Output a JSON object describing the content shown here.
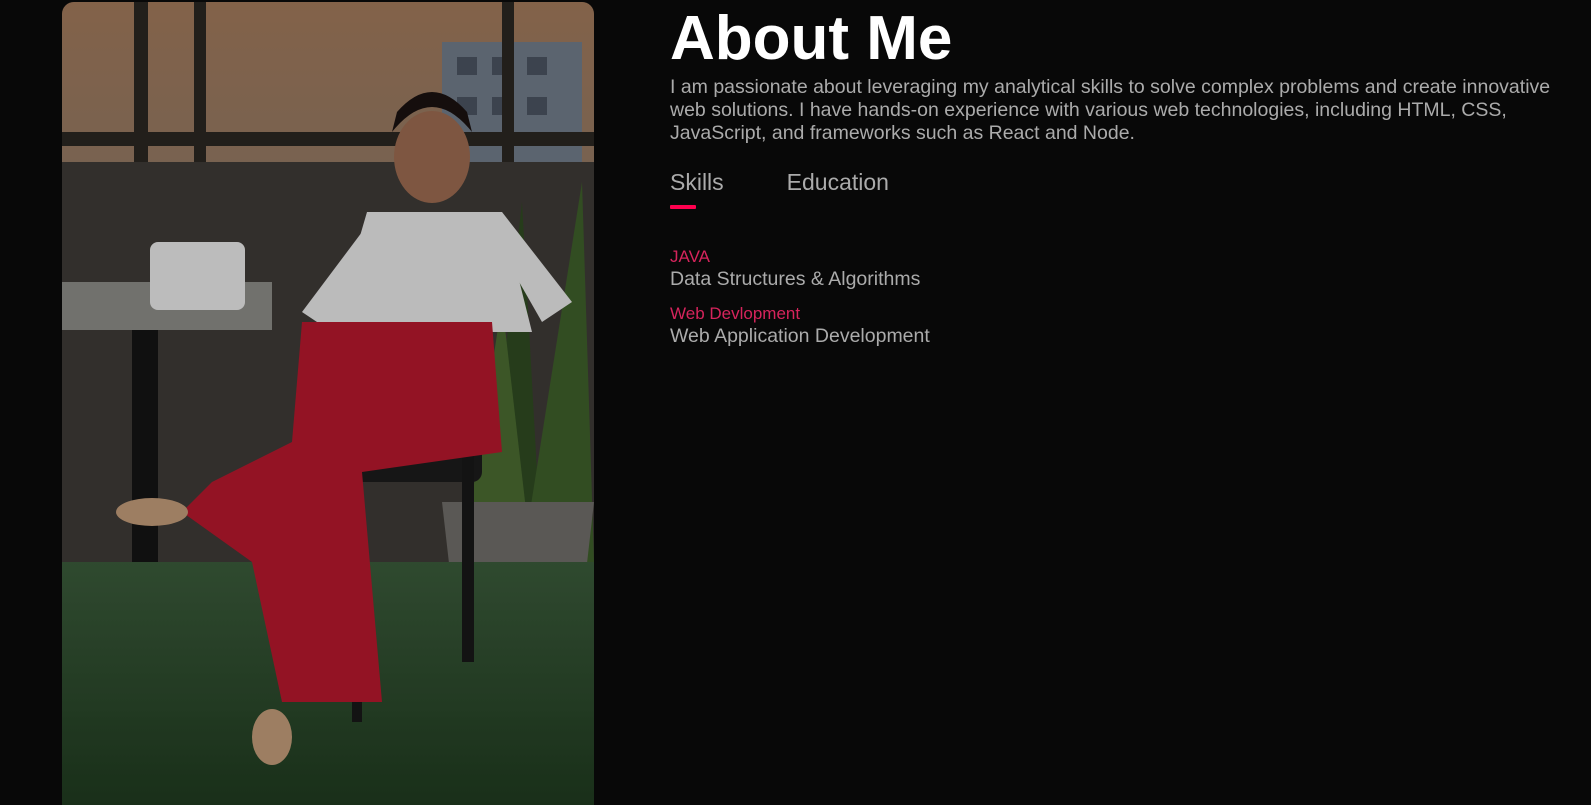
{
  "about": {
    "title": "About Me",
    "intro": "I am passionate about leveraging my analytical skills to solve complex problems and create innovative web solutions. I have hands-on experience with various web technologies, including HTML, CSS, JavaScript, and frameworks such as React and Node."
  },
  "tabs": [
    {
      "label": "Skills",
      "active": true
    },
    {
      "label": "Education",
      "active": false
    }
  ],
  "skills": [
    {
      "name": "JAVA",
      "description": "Data Structures & Algorithms"
    },
    {
      "name": "Web Devlopment",
      "description": "Web Application Development"
    }
  ],
  "colors": {
    "background": "#080808",
    "accent": "#ff004f",
    "text": "#ababab",
    "heading": "#ffffff"
  }
}
